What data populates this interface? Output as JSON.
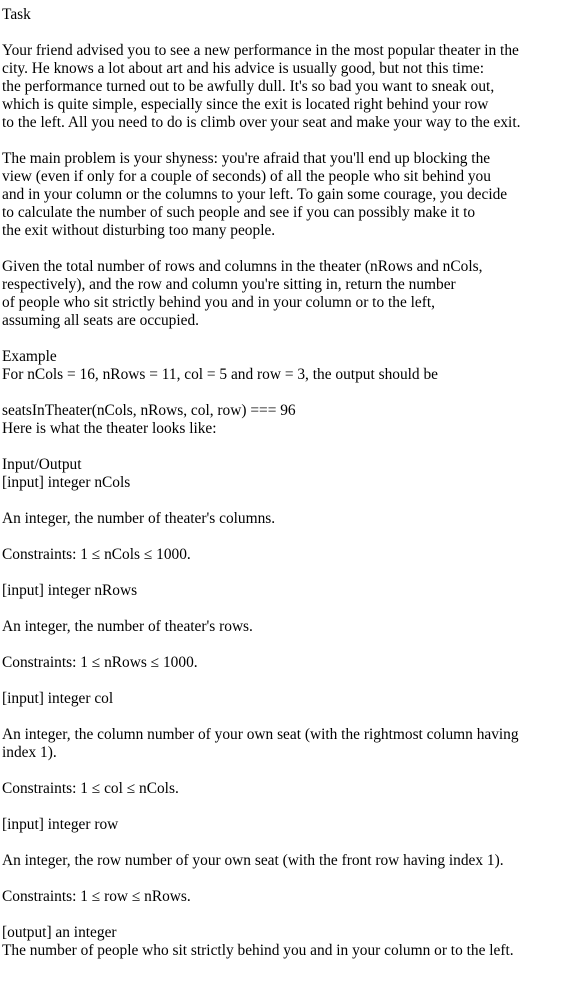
{
  "task": {
    "heading": "Task",
    "paragraph1": [
      "Your friend advised you to see a new performance in the most popular theater in the",
      "city. He knows a lot about art and his advice is usually good, but not this time:",
      "the performance turned out to be awfully dull. It's so bad you want to sneak out,",
      "which is quite simple, especially since the exit is located right behind your row",
      "to the left. All you need to do is climb over your seat and make your way to the exit."
    ],
    "paragraph2": [
      "The main problem is your shyness: you're afraid that you'll end up blocking the",
      "view (even if only for a couple of seconds) of all the people who sit behind you",
      "and in your column or the columns to your left. To gain some courage, you decide",
      "to calculate the number of such people and see if you can possibly make it to",
      "the exit without disturbing too many people."
    ],
    "paragraph3": [
      "Given the total number of rows and columns in the theater (nRows and nCols,",
      "respectively), and the row and column you're sitting in, return the number",
      "of people who sit strictly behind you and in your column or to the left,",
      "assuming all seats are occupied."
    ]
  },
  "example": {
    "heading": "Example",
    "line1": "For nCols = 16, nRows = 11, col = 5 and row = 3, the output should be",
    "call": "seatsInTheater(nCols, nRows, col, row) === 96",
    "theater_note": "Here is what the theater looks like:"
  },
  "io": {
    "heading": "Input/Output",
    "ncols_label": "[input] integer nCols",
    "ncols_desc": "An integer, the number of theater's columns.",
    "ncols_constraints": "Constraints: 1 ≤ nCols ≤ 1000.",
    "nrows_label": "[input] integer nRows",
    "nrows_desc": "An integer, the number of theater's rows.",
    "nrows_constraints": "Constraints: 1 ≤ nRows ≤ 1000.",
    "col_label": "[input] integer col",
    "col_desc_line1": "An integer, the column number of your own seat (with the rightmost column having",
    "col_desc_line2": "index 1).",
    "col_constraints": "Constraints: 1 ≤ col ≤ nCols.",
    "row_label": "[input] integer row",
    "row_desc": "An integer, the row number of your own seat (with the front row having index 1).",
    "row_constraints": "Constraints: 1 ≤ row ≤ nRows.",
    "output_label": "[output] an integer",
    "output_desc": "The number of people who sit strictly behind you and in your column or to the left."
  }
}
